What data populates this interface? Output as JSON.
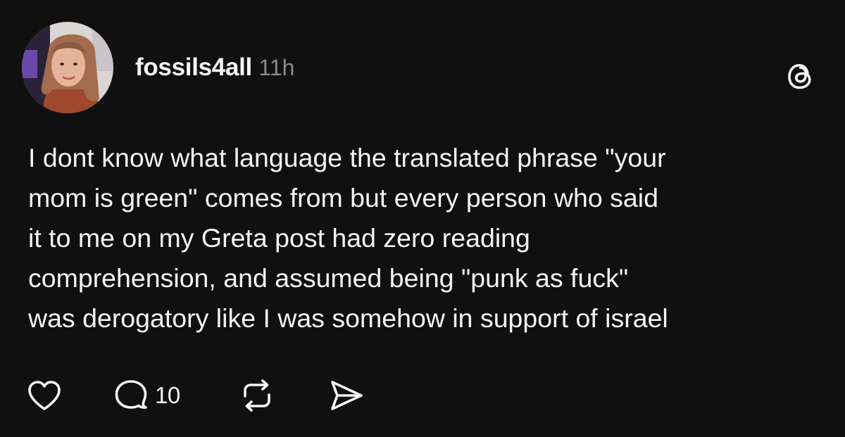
{
  "post": {
    "username": "fossils4all",
    "timestamp": "11h",
    "text_lines": [
      "I dont know what language the translated phrase \"your",
      "mom is green\" comes from but every person who said",
      "it to me on my Greta post had zero reading",
      "comprehension, and assumed being \"punk as fuck\"",
      "was derogatory like I was somehow in support of israel"
    ]
  },
  "actions": {
    "like_icon": "heart-icon",
    "reply_icon": "speech-bubble-icon",
    "reply_count": "10",
    "repost_icon": "repost-arrows-icon",
    "share_icon": "paper-plane-icon"
  },
  "branding": {
    "logo_icon": "threads-logo-icon"
  },
  "colors": {
    "background": "#101010",
    "text": "#f3f5f7",
    "muted": "#8a8a8a"
  }
}
